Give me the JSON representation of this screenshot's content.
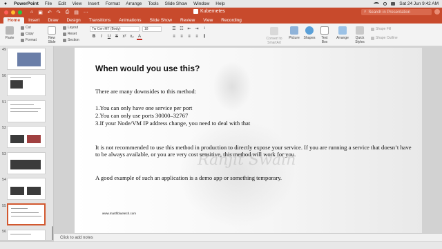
{
  "menubar": {
    "app": "PowerPoint",
    "items": [
      "File",
      "Edit",
      "View",
      "Insert",
      "Format",
      "Arrange",
      "Tools",
      "Slide Show",
      "Window",
      "Help"
    ],
    "clock": "Sat 24 Jun  9:42 AM"
  },
  "window": {
    "doc_title": "Kubernetes",
    "search_placeholder": "Search in Presentation"
  },
  "ribbon_tabs": [
    "Home",
    "Insert",
    "Draw",
    "Design",
    "Transitions",
    "Animations",
    "Slide Show",
    "Review",
    "View",
    "Recording"
  ],
  "ribbon": {
    "paste": "Paste",
    "cut": "Cut",
    "copy": "Copy",
    "format": "Format",
    "new_slide": "New Slide",
    "layout": "Layout",
    "reset": "Reset",
    "section": "Section",
    "font_name": "Tw Cen MT (Body)",
    "font_size": "18",
    "convert_smartart": "Convert to SmartArt",
    "picture": "Picture",
    "shapes": "Shapes",
    "text_box": "Text Box",
    "arrange": "Arrange",
    "quick_styles": "Quick Styles",
    "shape_fill": "Shape Fill",
    "shape_outline": "Shape Outline"
  },
  "thumbnails": {
    "numbers": [
      "49",
      "50",
      "51",
      "52",
      "53",
      "54",
      "55",
      "56"
    ],
    "selected": "55"
  },
  "slide": {
    "title": "When would you use this?",
    "intro": "There are many downsides to this method:",
    "points": [
      "1.You can only have one service per port",
      "2.You can only use ports 30000–32767",
      "3.If your Node/VM IP address change, you need to deal with that"
    ],
    "para1": "It is not recommended to use this method in production to directly expose your service. If you are running a service that doesn’t have to be always available, or you are very cost sensitive, this method will work for you.",
    "para2": "A good example of such an application is a demo app or something temporary.",
    "watermark": "Ranjit Swain",
    "url": "www.marthbluetech.com"
  },
  "notes_placeholder": "Click to add notes",
  "colors": {
    "accent": "#c84a2c",
    "selected_border": "#d2582f"
  }
}
